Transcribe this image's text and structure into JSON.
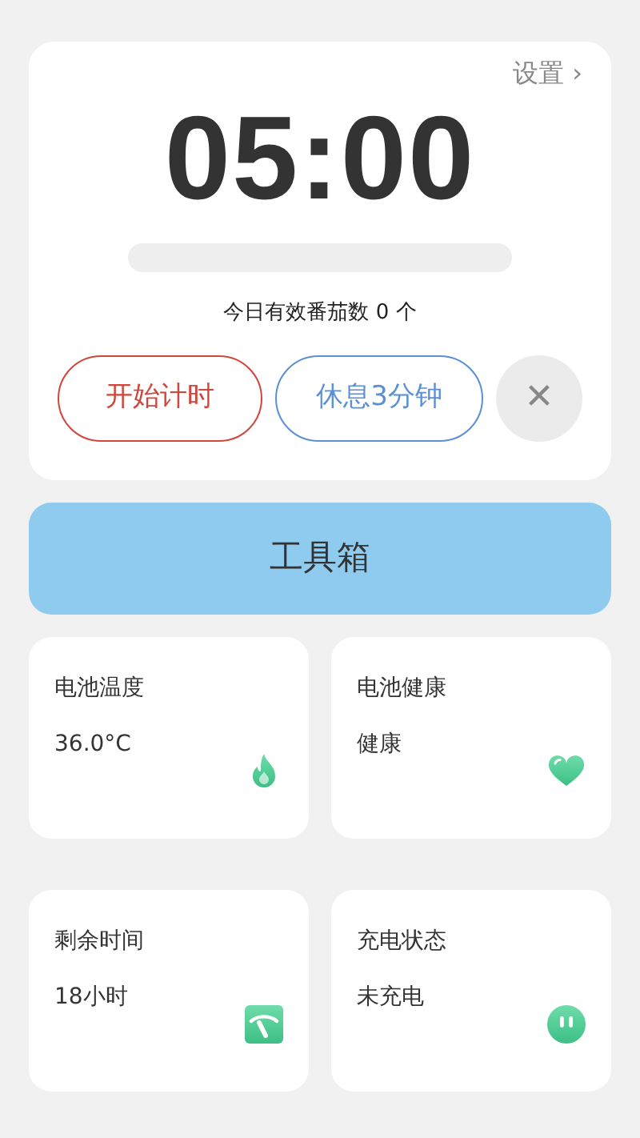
{
  "timer": {
    "settings_link": "设置",
    "settings_arrow": "›",
    "time": "05:00",
    "progress": {
      "level": 0
    },
    "count_text": "今日有效番茄数 0 个",
    "buttons": [
      {
        "kind": "start",
        "label": "开始计时"
      },
      {
        "kind": "rest",
        "label": "休息3分钟"
      },
      {
        "kind": "close",
        "label": "✕"
      }
    ]
  },
  "toolbox": {
    "label": "工具箱"
  },
  "stats": [
    {
      "kind": "flame",
      "title": "电池温度",
      "value": "36.0°C"
    },
    {
      "kind": "heart",
      "title": "电池健康",
      "value": "健康"
    },
    {
      "kind": "gauge",
      "title": "剩余时间",
      "value": "18小时"
    },
    {
      "kind": "plug",
      "title": "充电状态",
      "value": "未充电"
    }
  ]
}
